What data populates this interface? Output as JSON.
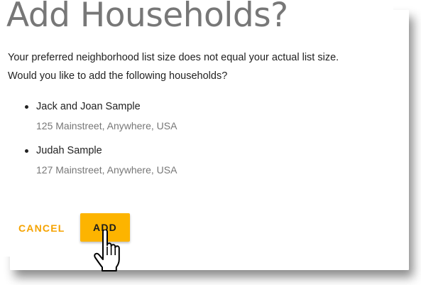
{
  "dialog": {
    "title": "Add Households?",
    "message_line1": "Your preferred neighborhood list size does not equal your actual list size.",
    "message_line2": "Would you like to add the following households?",
    "households": [
      {
        "name": "Jack and Joan Sample",
        "address": "125 Mainstreet, Anywhere, USA"
      },
      {
        "name": "Judah Sample",
        "address": "127 Mainstreet, Anywhere, USA"
      }
    ],
    "cancel_label": "CANCEL",
    "add_label": "ADD"
  },
  "colors": {
    "accent": "#fdb400",
    "cancel_text": "#f5a300",
    "title_text": "#777777",
    "secondary_text": "#777777"
  },
  "cursor_icon": "hand-pointer-icon"
}
